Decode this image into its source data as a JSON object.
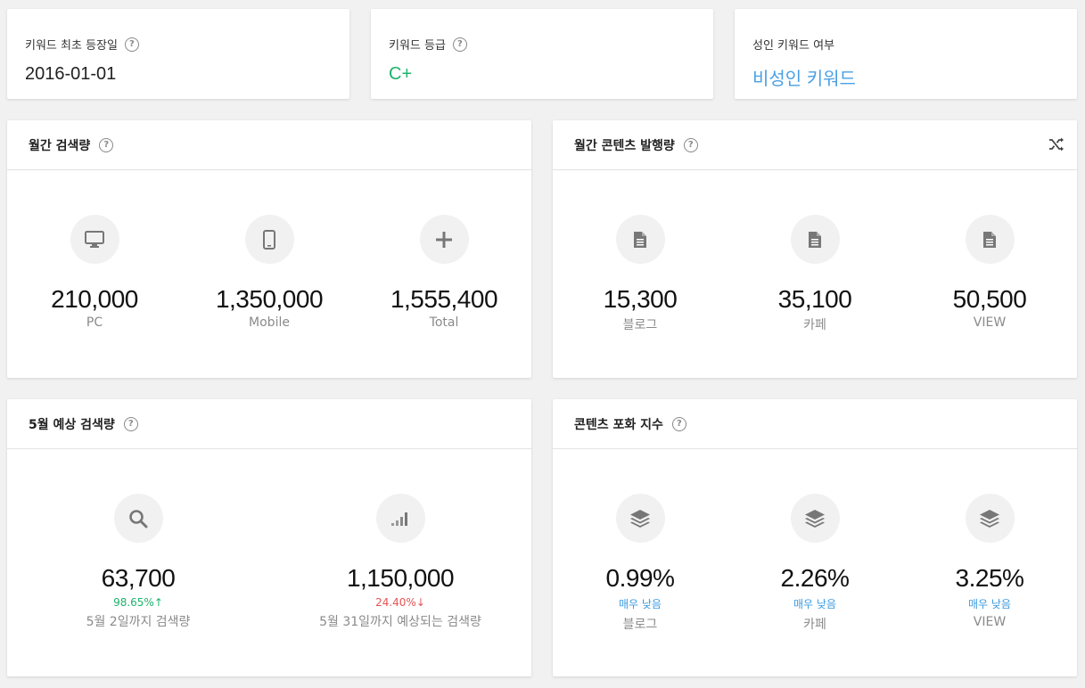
{
  "info": {
    "first_date": {
      "label": "키워드 최초 등장일",
      "value": "2016-01-01"
    },
    "grade": {
      "label": "키워드 등급",
      "value": "C+",
      "color": "#1db36a"
    },
    "adult": {
      "label": "성인 키워드 여부",
      "value": "비성인 키워드",
      "color": "#4aa0e6"
    }
  },
  "monthly_search": {
    "title": "월간 검색량",
    "items": [
      {
        "icon": "monitor-icon",
        "value": "210,000",
        "label": "PC"
      },
      {
        "icon": "mobile-icon",
        "value": "1,350,000",
        "label": "Mobile"
      },
      {
        "icon": "plus-icon",
        "value": "1,555,400",
        "label": "Total"
      }
    ]
  },
  "monthly_content": {
    "title": "월간 콘텐츠 발행량",
    "items": [
      {
        "icon": "document-icon",
        "value": "15,300",
        "label": "블로그"
      },
      {
        "icon": "document-icon",
        "value": "35,100",
        "label": "카페"
      },
      {
        "icon": "document-icon",
        "value": "50,500",
        "label": "VIEW"
      }
    ]
  },
  "forecast": {
    "title": "5월 예상 검색량",
    "items": [
      {
        "icon": "search-icon",
        "value": "63,700",
        "change": "98.65%",
        "arrow": "↑",
        "label": "5월 2일까지 검색량"
      },
      {
        "icon": "signal-icon",
        "value": "1,150,000",
        "change": "24.40%",
        "arrow": "↓",
        "label": "5월 31일까지 예상되는 검색량"
      }
    ]
  },
  "saturation": {
    "title": "콘텐츠 포화 지수",
    "items": [
      {
        "icon": "layers-icon",
        "value": "0.99%",
        "level": "매우 낮음",
        "label": "블로그"
      },
      {
        "icon": "layers-icon",
        "value": "2.26%",
        "level": "매우 낮음",
        "label": "카페"
      },
      {
        "icon": "layers-icon",
        "value": "3.25%",
        "level": "매우 낮음",
        "label": "VIEW"
      }
    ]
  },
  "help_glyph": "?"
}
